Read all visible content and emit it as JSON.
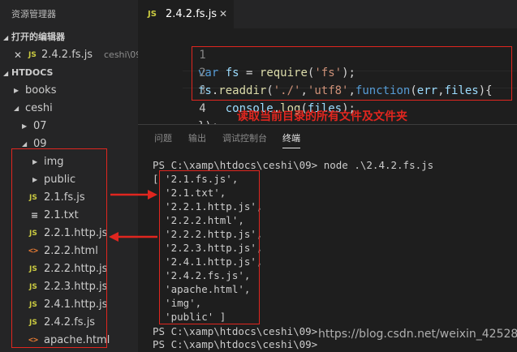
{
  "sidebar": {
    "title": "资源管理器",
    "open_editors_label": "打开的编辑器",
    "open_file": {
      "name": "2.4.2.fs.js",
      "folder": "ceshi\\09"
    },
    "root_label": "HTDOCS",
    "tree": {
      "books": "books",
      "ceshi": "ceshi",
      "f07": "07",
      "f09": "09",
      "img": "img",
      "public": "public",
      "file1": "2.1.fs.js",
      "file2": "2.1.txt",
      "file3": "2.2.1.http.js",
      "file4": "2.2.2.html",
      "file5": "2.2.2.http.js",
      "file6": "2.2.3.http.js",
      "file7": "2.4.1.http.js",
      "file8": "2.4.2.fs.js",
      "file9": "apache.html"
    }
  },
  "tab": {
    "label": "2.4.2.fs.js",
    "icon": "JS"
  },
  "editor": {
    "line_numbers": [
      "1",
      "2",
      "3",
      "4"
    ],
    "l1": {
      "kw": "var",
      "sp1": " ",
      "id": "fs",
      "eq": " = ",
      "fn": "require",
      "p1": "(",
      "str": "'fs'",
      "p2": ");"
    },
    "l2": {
      "id": "fs",
      "dot": ".",
      "fn": "readdir",
      "p1": "(",
      "s1": "'./'",
      "c1": ",",
      "s2": "'utf8'",
      "c2": ",",
      "kw": "function",
      "p2": "(",
      "a1": "err",
      "c3": ",",
      "a2": "files",
      "p3": "){"
    },
    "l3": {
      "indent": "    ",
      "id": "console",
      "dot": ".",
      "fn": "log",
      "p1": "(",
      "arg": "files",
      "p2": ");"
    },
    "l4": {
      "text": "});"
    }
  },
  "annotation": {
    "caption": "读取当前目录的所有文件及文件夹"
  },
  "panel": {
    "tabs": [
      "问题",
      "输出",
      "调试控制台",
      "终端"
    ],
    "terminal": {
      "prompt_line": "PS C:\\xamp\\htdocs\\ceshi\\09> node .\\2.4.2.fs.js",
      "output": [
        "[ '2.1.fs.js',",
        "  '2.1.txt',",
        "  '2.2.1.http.js',",
        "  '2.2.2.html',",
        "  '2.2.2.http.js',",
        "  '2.2.3.http.js',",
        "  '2.4.1.http.js',",
        "  '2.4.2.fs.js',",
        "  'apache.html',",
        "  'img',",
        "  'public' ]"
      ],
      "after1": "PS C:\\xamp\\htdocs\\ceshi\\09>",
      "after2": "PS C:\\xamp\\htdocs\\ceshi\\09>"
    }
  },
  "watermark": "https://blog.csdn.net/weixin_42528266",
  "colors": {
    "annotation_red": "#e0261f",
    "js_icon": "#cbcb41",
    "html_icon": "#e37933"
  }
}
